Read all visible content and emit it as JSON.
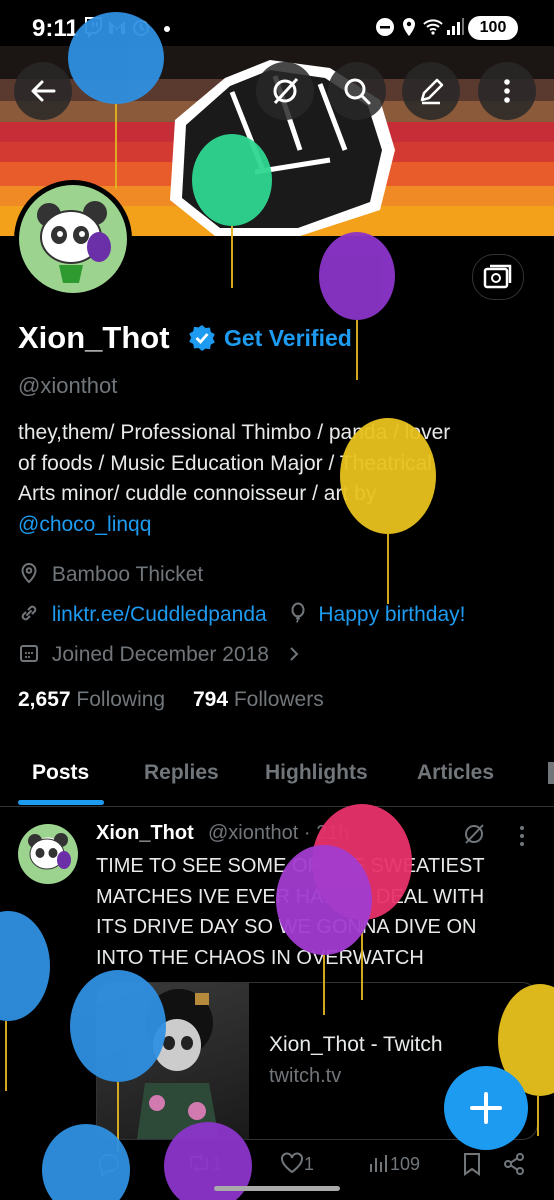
{
  "status_bar": {
    "time": "9:11",
    "battery": "100"
  },
  "profile": {
    "display_name": "Xion_Thot",
    "get_verified": "Get Verified",
    "handle": "@xionthot",
    "bio": {
      "line1": "they,them/ Professional Thimbo / panda / lover",
      "line2": "of foods / Music Education Major / Theatrical",
      "line3": "Arts minor/ cuddle connoisseur / art by",
      "mention": "@choco_linqq"
    },
    "location": "Bamboo Thicket",
    "website": "linktr.ee/Cuddledpanda",
    "birthday": "Happy birthday!",
    "joined": "Joined December 2018",
    "following_count": "2,657",
    "following_label": "Following",
    "followers_count": "794",
    "followers_label": "Followers"
  },
  "tabs": [
    {
      "label": "Posts"
    },
    {
      "label": "Replies"
    },
    {
      "label": "Highlights"
    },
    {
      "label": "Articles"
    }
  ],
  "post": {
    "author": "Xion_Thot",
    "handle_time": "@xionthot · 21h",
    "text": {
      "line1": "TIME TO SEE SOME OF THE SWEATIEST",
      "line2": "MATCHES IVE EVER HAD TO DEAL WITH",
      "line3": "ITS DRIVE DAY SO WE GONNA DIVE ON",
      "line4": "INTO THE CHAOS IN OVERWATCH"
    },
    "card": {
      "title": "Xion_Thot - Twitch",
      "domain": "twitch.tv"
    },
    "actions": {
      "reposts": "1",
      "likes": "1",
      "views": "109"
    }
  },
  "colors": {
    "accent": "#1d9bf0",
    "background": "#000000",
    "muted": "#71767b"
  },
  "icons": [
    "back-arrow-icon",
    "grok-icon",
    "search-icon",
    "edit-icon",
    "more-icon",
    "edit-image-icon",
    "verified-icon",
    "location-icon",
    "link-icon",
    "balloon-icon",
    "calendar-icon",
    "reply-icon",
    "repost-icon",
    "like-icon",
    "views-icon",
    "bookmark-icon",
    "share-icon",
    "plus-icon"
  ]
}
